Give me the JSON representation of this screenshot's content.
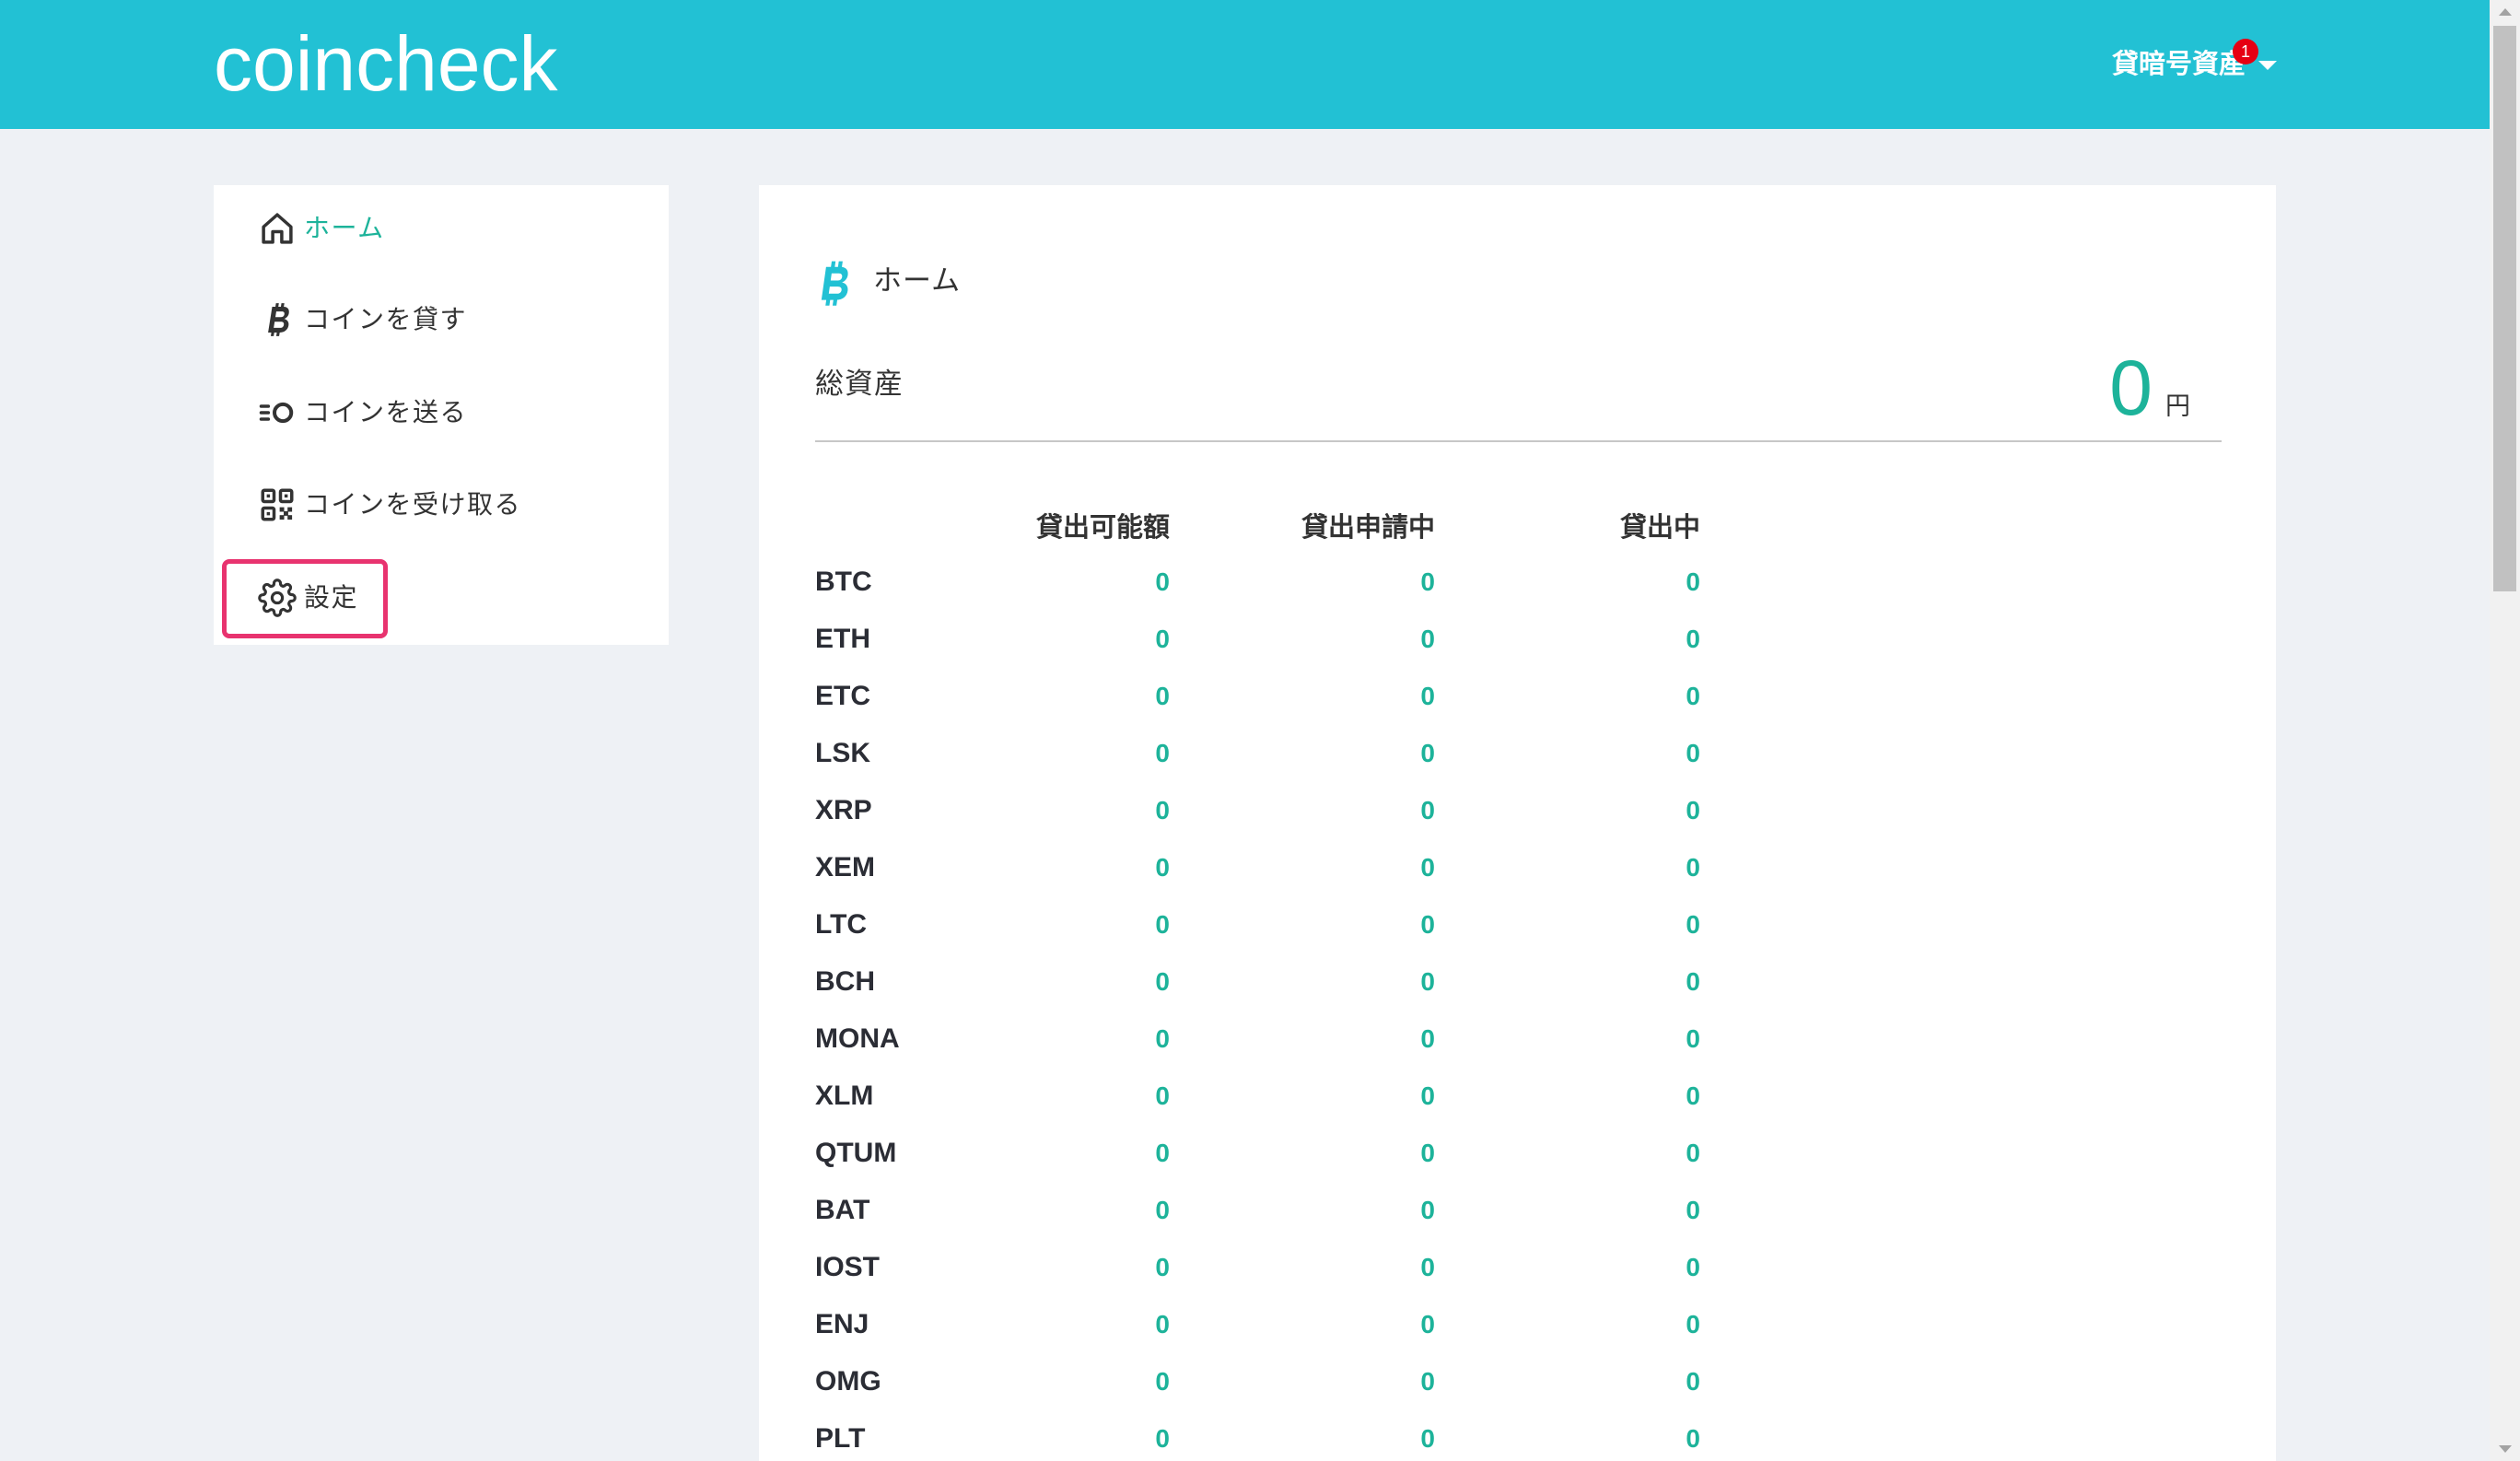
{
  "colors": {
    "header_bg": "#22c1d4",
    "accent": "#1db39a",
    "highlight": "#e8336f",
    "badge": "#e60012",
    "page_bg": "#eef1f5",
    "title_icon": "#22c1d4"
  },
  "header": {
    "logo": "coincheck",
    "menu_label": "貸暗号資産",
    "badge_count": "1",
    "menu_icon": "chevron-down-icon"
  },
  "sidebar": {
    "items": [
      {
        "label": "ホーム",
        "icon": "home-icon",
        "active": true
      },
      {
        "label": "コインを貸す",
        "icon": "bitcoin-icon",
        "active": false
      },
      {
        "label": "コインを送る",
        "icon": "send-icon",
        "active": false
      },
      {
        "label": "コインを受け取る",
        "icon": "qr-code-icon",
        "active": false
      },
      {
        "label": "設定",
        "icon": "gear-icon",
        "active": false,
        "highlighted": true
      }
    ]
  },
  "main": {
    "title": "ホーム",
    "title_icon": "bitcoin-icon",
    "total_assets": {
      "label": "総資産",
      "value": "0",
      "unit": "円"
    },
    "table": {
      "columns": [
        "貸出可能額",
        "貸出申請中",
        "貸出中"
      ],
      "rows": [
        {
          "coin": "BTC",
          "available": "0",
          "pending": "0",
          "lending": "0"
        },
        {
          "coin": "ETH",
          "available": "0",
          "pending": "0",
          "lending": "0"
        },
        {
          "coin": "ETC",
          "available": "0",
          "pending": "0",
          "lending": "0"
        },
        {
          "coin": "LSK",
          "available": "0",
          "pending": "0",
          "lending": "0"
        },
        {
          "coin": "XRP",
          "available": "0",
          "pending": "0",
          "lending": "0"
        },
        {
          "coin": "XEM",
          "available": "0",
          "pending": "0",
          "lending": "0"
        },
        {
          "coin": "LTC",
          "available": "0",
          "pending": "0",
          "lending": "0"
        },
        {
          "coin": "BCH",
          "available": "0",
          "pending": "0",
          "lending": "0"
        },
        {
          "coin": "MONA",
          "available": "0",
          "pending": "0",
          "lending": "0"
        },
        {
          "coin": "XLM",
          "available": "0",
          "pending": "0",
          "lending": "0"
        },
        {
          "coin": "QTUM",
          "available": "0",
          "pending": "0",
          "lending": "0"
        },
        {
          "coin": "BAT",
          "available": "0",
          "pending": "0",
          "lending": "0"
        },
        {
          "coin": "IOST",
          "available": "0",
          "pending": "0",
          "lending": "0"
        },
        {
          "coin": "ENJ",
          "available": "0",
          "pending": "0",
          "lending": "0"
        },
        {
          "coin": "OMG",
          "available": "0",
          "pending": "0",
          "lending": "0"
        },
        {
          "coin": "PLT",
          "available": "0",
          "pending": "0",
          "lending": "0"
        }
      ]
    }
  }
}
